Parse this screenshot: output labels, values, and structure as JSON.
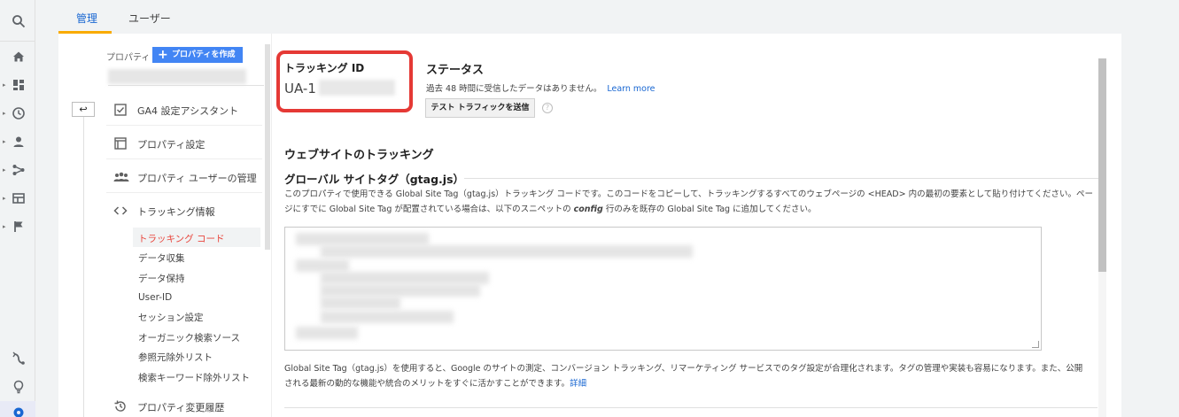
{
  "rail": {
    "icons": [
      "search-icon",
      "home-icon",
      "dashboard-icon",
      "clock-icon",
      "person-icon",
      "acquisition-icon",
      "behavior-icon",
      "flag-icon",
      "share-icon",
      "lightbulb-icon",
      "gear-icon"
    ]
  },
  "tabs": [
    {
      "label": "管理",
      "active": true
    },
    {
      "label": "ユーザー",
      "active": false
    }
  ],
  "property": {
    "label": "プロパティ",
    "create_button": "プロパティを作成"
  },
  "menu": {
    "items": [
      {
        "label": "GA4 設定アシスタント",
        "icon": "checkbox-icon"
      },
      {
        "label": "プロパティ設定",
        "icon": "window-icon"
      },
      {
        "label": "プロパティ ユーザーの管理",
        "icon": "users-icon"
      },
      {
        "label": "トラッキング情報",
        "icon": "code-icon"
      }
    ],
    "sub_items": [
      {
        "label": "トラッキング コード",
        "active": true
      },
      {
        "label": "データ収集",
        "active": false
      },
      {
        "label": "データ保持",
        "active": false
      },
      {
        "label": "User-ID",
        "active": false
      },
      {
        "label": "セッション設定",
        "active": false
      },
      {
        "label": "オーガニック検索ソース",
        "active": false
      },
      {
        "label": "参照元除外リスト",
        "active": false
      },
      {
        "label": "検索キーワード除外リスト",
        "active": false
      }
    ],
    "history": {
      "label": "プロパティ変更履歴",
      "icon": "history-icon"
    }
  },
  "tracking": {
    "title": "トラッキング ID",
    "value": "UA-1"
  },
  "status": {
    "title": "ステータス",
    "text": "過去 48 時間に受信したデータはありません。",
    "learn_more": "Learn more",
    "test_button": "テスト トラフィックを送信",
    "help": "?"
  },
  "web_tracking": {
    "heading": "ウェブサイトのトラッキング",
    "gtag_heading": "グローバル サイトタグ（gtag.js）",
    "desc_1": "このプロパティで使用できる Global Site Tag（gtag.js）トラッキング コードです。このコードをコピーして、トラッキングするすべてのウェブページの <HEAD> 内の最初の要素として貼り付けてください。ページにすでに Global Site Tag が配置されている場合は、以下のスニペットの ",
    "desc_config": "config",
    "desc_2": " 行のみを既存の Global Site Tag に追加してください。",
    "footer": "Global Site Tag（gtag.js）を使用すると、Google のサイトの測定、コンバージョン トラッキング、リマーケティング サービスでのタグ設定が合理化されます。タグの管理や実装も容易になります。また、公開される最新の動的な機能や統合のメリットをすぐに活かすことができます。",
    "footer_link": "詳細"
  },
  "colors": {
    "accent": "#1967d2",
    "highlight_box": "#e53935",
    "active_sub": "#e8453c",
    "tab_underline": "#f9ab00",
    "create_button": "#4285f4"
  }
}
